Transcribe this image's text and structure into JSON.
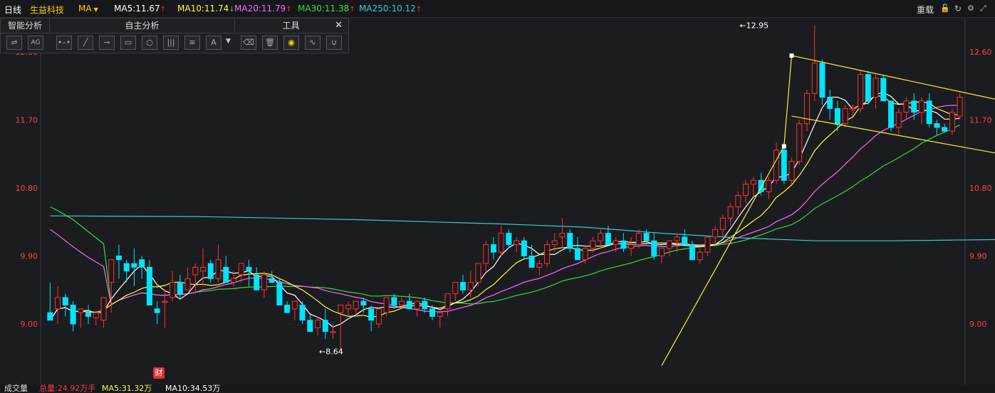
{
  "header": {
    "period": "日线",
    "stock_name": "生益科技",
    "indicator": "MA",
    "ma": [
      {
        "label": "MA5:11.67",
        "trend": "up",
        "color": "#ffffff"
      },
      {
        "label": "MA10:11.74",
        "trend": "down",
        "color": "#ffff33"
      },
      {
        "label": "MA20:11.79",
        "trend": "up",
        "color": "#ff66ff"
      },
      {
        "label": "MA30:11.38",
        "trend": "up",
        "color": "#33dd33"
      },
      {
        "label": "MA250:10.12",
        "trend": "up",
        "color": "#33cccc"
      }
    ],
    "right_label": "重载"
  },
  "toolbar": {
    "section_smart": "智能分析",
    "section_self": "自主分析",
    "section_tools": "工具",
    "smart_btn2": "AG",
    "text_btn": "A",
    "close": "✕"
  },
  "badge": "财",
  "volume_bar": {
    "label": "成交量",
    "total": "总量:24.92万手",
    "ma5": "MA5:31.32万",
    "ma10": "MA10:34.53万"
  },
  "colors": {
    "up": "#ff3030",
    "down": "#00e5ff",
    "ma5": "#ffffff",
    "ma10": "#ffff33",
    "ma20": "#ff66ff",
    "ma30": "#33dd33",
    "ma250": "#33cccc",
    "trend": "#ffee33"
  },
  "chart_data": {
    "type": "candlestick",
    "ylim": [
      8.2,
      13.05
    ],
    "y_ticks": [
      "12.60",
      "11.70",
      "10.80",
      "9.90",
      "9.00"
    ],
    "y_tick_values": [
      12.6,
      11.7,
      10.8,
      9.9,
      9.0
    ],
    "annotations": [
      {
        "text": "←12.95",
        "index": 90,
        "value": 12.95
      },
      {
        "text": "←8.64",
        "index": 35,
        "value": 8.64
      }
    ],
    "candles": [
      [
        9.15,
        9.55,
        9.05,
        9.05
      ],
      [
        9.2,
        9.5,
        9.0,
        9.35
      ],
      [
        9.35,
        9.4,
        9.1,
        9.25
      ],
      [
        9.25,
        9.3,
        8.9,
        9.0
      ],
      [
        9.15,
        9.2,
        8.95,
        9.2
      ],
      [
        9.15,
        9.25,
        9.0,
        9.1
      ],
      [
        9.08,
        9.12,
        8.98,
        9.15
      ],
      [
        9.05,
        9.3,
        8.95,
        9.35
      ],
      [
        9.55,
        9.55,
        9.15,
        9.85
      ],
      [
        9.9,
        10.05,
        9.6,
        9.85
      ],
      [
        9.8,
        9.85,
        9.55,
        9.7
      ],
      [
        9.8,
        10.0,
        9.5,
        9.75
      ],
      [
        9.85,
        9.9,
        9.6,
        9.75
      ],
      [
        9.75,
        9.85,
        9.6,
        9.25
      ],
      [
        9.2,
        9.3,
        9.0,
        9.15
      ],
      [
        9.3,
        9.45,
        8.95,
        9.3
      ],
      [
        9.35,
        9.7,
        9.3,
        9.55
      ],
      [
        9.55,
        9.65,
        9.35,
        9.4
      ],
      [
        9.45,
        9.75,
        9.45,
        9.6
      ],
      [
        9.65,
        9.8,
        9.4,
        9.75
      ],
      [
        9.7,
        10.0,
        9.5,
        9.75
      ],
      [
        9.8,
        9.85,
        9.55,
        9.6
      ],
      [
        9.6,
        10.05,
        9.55,
        9.85
      ],
      [
        9.75,
        9.9,
        9.55,
        9.55
      ],
      [
        9.55,
        9.7,
        9.5,
        9.6
      ],
      [
        9.65,
        9.8,
        9.55,
        9.8
      ],
      [
        9.75,
        9.85,
        9.5,
        9.7
      ],
      [
        9.65,
        9.75,
        9.45,
        9.45
      ],
      [
        9.45,
        9.7,
        9.35,
        9.65
      ],
      [
        9.6,
        9.7,
        9.55,
        9.55
      ],
      [
        9.55,
        9.6,
        9.25,
        9.25
      ],
      [
        9.25,
        9.3,
        9.15,
        9.15
      ],
      [
        9.2,
        9.3,
        9.05,
        9.3
      ],
      [
        9.25,
        9.3,
        9.0,
        9.05
      ],
      [
        9.05,
        9.15,
        8.95,
        8.9
      ],
      [
        8.95,
        9.1,
        8.85,
        9.05
      ],
      [
        9.05,
        9.2,
        8.8,
        8.9
      ],
      [
        8.9,
        9.0,
        8.8,
        8.9
      ],
      [
        9.15,
        9.2,
        8.64,
        9.25
      ],
      [
        9.2,
        9.3,
        9.1,
        9.25
      ],
      [
        9.2,
        9.3,
        9.1,
        9.3
      ],
      [
        9.3,
        9.35,
        9.15,
        9.25
      ],
      [
        9.2,
        9.25,
        8.9,
        9.05
      ],
      [
        9.0,
        9.1,
        8.95,
        9.2
      ],
      [
        9.15,
        9.3,
        9.1,
        9.35
      ],
      [
        9.35,
        9.4,
        9.2,
        9.25
      ],
      [
        9.25,
        9.35,
        9.2,
        9.3
      ],
      [
        9.3,
        9.4,
        9.2,
        9.2
      ],
      [
        9.2,
        9.3,
        9.1,
        9.3
      ],
      [
        9.3,
        9.35,
        9.15,
        9.2
      ],
      [
        9.2,
        9.25,
        9.05,
        9.1
      ],
      [
        9.1,
        9.15,
        8.95,
        9.15
      ],
      [
        9.2,
        9.4,
        9.1,
        9.4
      ],
      [
        9.4,
        9.55,
        9.3,
        9.55
      ],
      [
        9.55,
        9.65,
        9.4,
        9.45
      ],
      [
        9.45,
        9.7,
        9.35,
        9.55
      ],
      [
        9.55,
        9.8,
        9.5,
        9.8
      ],
      [
        9.8,
        10.1,
        9.7,
        10.05
      ],
      [
        10.05,
        10.15,
        9.85,
        9.95
      ],
      [
        9.95,
        10.3,
        9.9,
        10.2
      ],
      [
        10.2,
        10.25,
        10.0,
        10.05
      ],
      [
        10.05,
        10.15,
        9.95,
        10.1
      ],
      [
        10.1,
        10.15,
        9.85,
        9.9
      ],
      [
        9.9,
        10.05,
        9.8,
        9.75
      ],
      [
        9.75,
        9.85,
        9.65,
        9.8
      ],
      [
        9.8,
        10.1,
        9.75,
        10.05
      ],
      [
        10.05,
        10.2,
        9.95,
        10.1
      ],
      [
        10.15,
        10.4,
        10.0,
        10.2
      ],
      [
        10.2,
        10.25,
        9.95,
        10.0
      ],
      [
        10.0,
        10.15,
        9.9,
        9.85
      ],
      [
        9.85,
        10.05,
        9.8,
        10.0
      ],
      [
        10.0,
        10.15,
        9.95,
        10.1
      ],
      [
        10.1,
        10.25,
        10.0,
        10.2
      ],
      [
        10.2,
        10.3,
        10.1,
        10.05
      ],
      [
        10.05,
        10.15,
        9.95,
        10.1
      ],
      [
        10.1,
        10.2,
        9.95,
        10.0
      ],
      [
        10.0,
        10.15,
        9.9,
        10.05
      ],
      [
        10.05,
        10.25,
        10.0,
        10.2
      ],
      [
        10.2,
        10.25,
        10.05,
        10.1
      ],
      [
        10.1,
        10.2,
        9.85,
        9.9
      ],
      [
        9.9,
        10.0,
        9.8,
        10.0
      ],
      [
        10.0,
        10.1,
        9.9,
        10.1
      ],
      [
        10.1,
        10.2,
        9.95,
        10.15
      ],
      [
        10.15,
        10.25,
        10.05,
        10.05
      ],
      [
        10.05,
        10.1,
        9.85,
        9.85
      ],
      [
        9.85,
        10.0,
        9.8,
        9.95
      ],
      [
        9.95,
        10.15,
        9.9,
        10.15
      ],
      [
        10.15,
        10.3,
        10.05,
        10.25
      ],
      [
        10.25,
        10.45,
        10.15,
        10.4
      ],
      [
        10.4,
        10.6,
        10.3,
        10.55
      ],
      [
        10.55,
        10.75,
        10.45,
        10.7
      ],
      [
        10.7,
        10.9,
        10.6,
        10.85
      ],
      [
        10.85,
        10.95,
        10.7,
        10.9
      ],
      [
        10.9,
        11.0,
        10.7,
        10.75
      ],
      [
        10.75,
        10.95,
        10.65,
        10.9
      ],
      [
        10.9,
        11.4,
        10.85,
        11.3
      ],
      [
        11.3,
        11.4,
        10.85,
        10.9
      ],
      [
        10.9,
        11.2,
        10.85,
        11.15
      ],
      [
        11.15,
        11.7,
        11.1,
        11.65
      ],
      [
        11.65,
        12.1,
        11.55,
        12.05
      ],
      [
        12.05,
        12.95,
        11.95,
        12.45
      ],
      [
        12.45,
        12.5,
        11.9,
        12.0
      ],
      [
        12.0,
        12.1,
        11.7,
        11.85
      ],
      [
        11.85,
        11.95,
        11.55,
        11.65
      ],
      [
        11.65,
        11.9,
        11.6,
        11.85
      ],
      [
        11.85,
        11.9,
        11.75,
        11.85
      ],
      [
        11.85,
        12.35,
        11.8,
        12.3
      ],
      [
        12.3,
        12.35,
        11.9,
        11.95
      ],
      [
        12.0,
        12.3,
        11.85,
        12.25
      ],
      [
        12.25,
        12.3,
        11.95,
        11.95
      ],
      [
        11.95,
        11.95,
        11.55,
        11.6
      ],
      [
        11.6,
        11.85,
        11.5,
        11.8
      ],
      [
        11.8,
        12.0,
        11.7,
        11.95
      ],
      [
        11.95,
        12.05,
        11.7,
        11.8
      ],
      [
        11.8,
        12.0,
        11.65,
        11.95
      ],
      [
        11.95,
        12.05,
        11.6,
        11.65
      ],
      [
        11.65,
        11.7,
        11.5,
        11.6
      ],
      [
        11.6,
        11.65,
        11.55,
        11.55
      ],
      [
        11.55,
        11.85,
        11.5,
        11.8
      ],
      [
        11.75,
        12.05,
        11.7,
        12.0
      ]
    ],
    "ma250": [
      [
        0,
        10.43
      ],
      [
        20,
        10.42
      ],
      [
        40,
        10.38
      ],
      [
        60,
        10.32
      ],
      [
        70,
        10.28
      ],
      [
        80,
        10.2
      ],
      [
        90,
        10.14
      ],
      [
        100,
        10.1
      ],
      [
        110,
        10.1
      ],
      [
        127,
        10.12
      ]
    ],
    "trendlines": [
      [
        [
          97,
          12.55
        ],
        [
          127,
          11.9
        ]
      ],
      [
        [
          97,
          11.75
        ],
        [
          127,
          11.2
        ]
      ],
      [
        [
          80,
          8.45
        ],
        [
          96,
          11.35
        ]
      ],
      [
        [
          96,
          11.35
        ],
        [
          97,
          12.55
        ]
      ]
    ]
  }
}
